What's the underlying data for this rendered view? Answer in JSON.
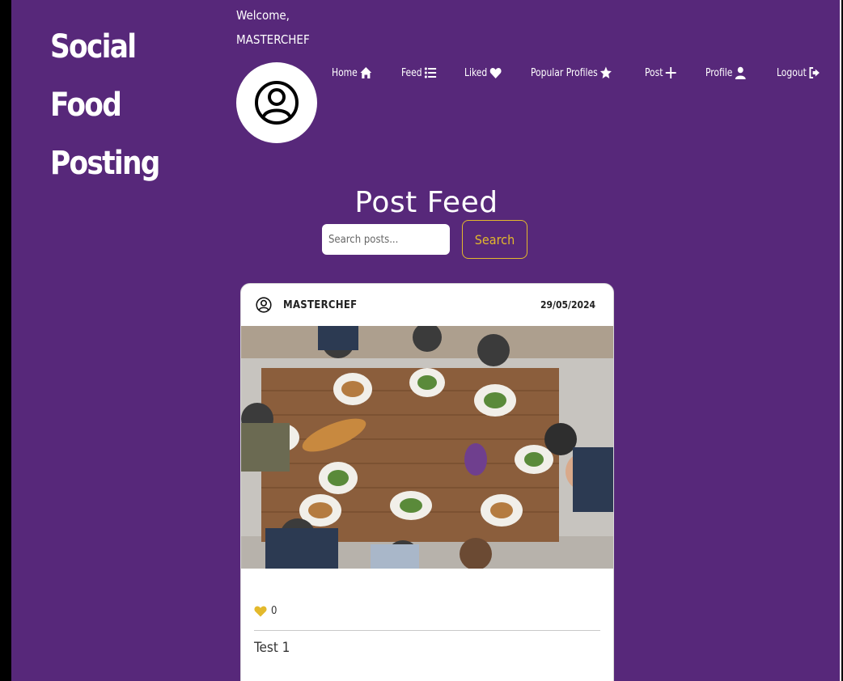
{
  "brand": {
    "title": "Social Food Posting"
  },
  "welcome": {
    "greeting": "Welcome,",
    "username": "MASTERCHEF"
  },
  "nav": {
    "items": [
      {
        "label": "Home",
        "icon": "home-icon"
      },
      {
        "label": "Feed",
        "icon": "list-icon"
      },
      {
        "label": "Liked",
        "icon": "heart-icon"
      },
      {
        "label": "Popular Profiles",
        "icon": "star-icon"
      },
      {
        "label": "Post",
        "icon": "plus-icon"
      },
      {
        "label": "Profile",
        "icon": "user-icon"
      },
      {
        "label": "Logout",
        "icon": "logout-icon"
      }
    ]
  },
  "page": {
    "title": "Post Feed"
  },
  "search": {
    "placeholder": "Search posts...",
    "button_label": "Search"
  },
  "post": {
    "username": "MASTERCHEF",
    "date": "29/05/2024",
    "likes": "0",
    "caption": "Test 1"
  },
  "colors": {
    "background": "#57287a",
    "accent": "#e3b92c",
    "card": "#ffffff"
  }
}
